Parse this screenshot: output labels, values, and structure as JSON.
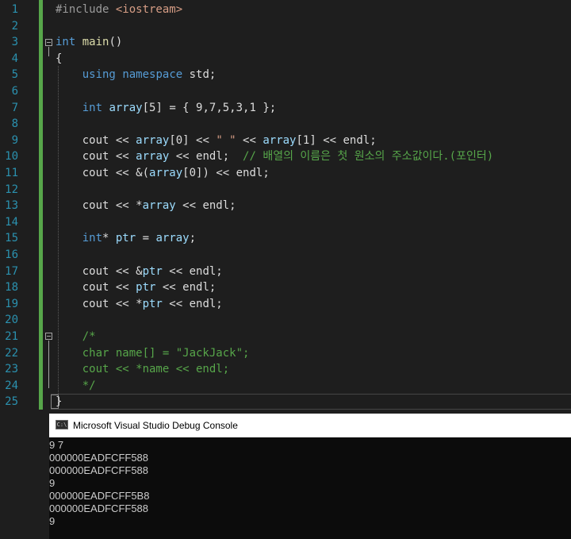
{
  "editor": {
    "line_numbers": [
      "1",
      "2",
      "3",
      "4",
      "5",
      "6",
      "7",
      "8",
      "9",
      "10",
      "11",
      "12",
      "13",
      "14",
      "15",
      "16",
      "17",
      "18",
      "19",
      "20",
      "21",
      "22",
      "23",
      "24",
      "25"
    ],
    "lines": [
      [
        {
          "t": "#include ",
          "c": "pp"
        },
        {
          "t": "<iostream>",
          "c": "inc"
        }
      ],
      [],
      [
        {
          "t": "int",
          "c": "kw"
        },
        {
          "t": " "
        },
        {
          "t": "main",
          "c": "fn"
        },
        {
          "t": "()"
        }
      ],
      [
        {
          "t": "{"
        }
      ],
      [
        {
          "t": "    "
        },
        {
          "t": "using",
          "c": "kw"
        },
        {
          "t": " "
        },
        {
          "t": "namespace",
          "c": "kw"
        },
        {
          "t": " std;"
        }
      ],
      [],
      [
        {
          "t": "    "
        },
        {
          "t": "int",
          "c": "kw"
        },
        {
          "t": " "
        },
        {
          "t": "array",
          "c": "var"
        },
        {
          "t": "[5] = { 9,7,5,3,1 };"
        }
      ],
      [],
      [
        {
          "t": "    cout << "
        },
        {
          "t": "array",
          "c": "var"
        },
        {
          "t": "[0] << "
        },
        {
          "t": "\" \"",
          "c": "str"
        },
        {
          "t": " << "
        },
        {
          "t": "array",
          "c": "var"
        },
        {
          "t": "[1] << endl;"
        }
      ],
      [
        {
          "t": "    cout << "
        },
        {
          "t": "array",
          "c": "var"
        },
        {
          "t": " << endl;  "
        },
        {
          "t": "// 배열의 이름은 첫 원소의 주소값이다.(포인터)",
          "c": "cmt"
        }
      ],
      [
        {
          "t": "    cout << &("
        },
        {
          "t": "array",
          "c": "var"
        },
        {
          "t": "[0]) << endl;"
        }
      ],
      [],
      [
        {
          "t": "    cout << *"
        },
        {
          "t": "array",
          "c": "var"
        },
        {
          "t": " << endl;"
        }
      ],
      [],
      [
        {
          "t": "    "
        },
        {
          "t": "int",
          "c": "kw"
        },
        {
          "t": "* "
        },
        {
          "t": "ptr",
          "c": "var"
        },
        {
          "t": " = "
        },
        {
          "t": "array",
          "c": "var"
        },
        {
          "t": ";"
        }
      ],
      [],
      [
        {
          "t": "    cout << &"
        },
        {
          "t": "ptr",
          "c": "var"
        },
        {
          "t": " << endl;"
        }
      ],
      [
        {
          "t": "    cout << "
        },
        {
          "t": "ptr",
          "c": "var"
        },
        {
          "t": " << endl;"
        }
      ],
      [
        {
          "t": "    cout << *"
        },
        {
          "t": "ptr",
          "c": "var"
        },
        {
          "t": " << endl;"
        }
      ],
      [],
      [
        {
          "t": "    "
        },
        {
          "t": "/*",
          "c": "cmt"
        }
      ],
      [
        {
          "t": "    "
        },
        {
          "t": "char name[] = \"JackJack\";",
          "c": "cmt"
        }
      ],
      [
        {
          "t": "    "
        },
        {
          "t": "cout << *name << endl;",
          "c": "cmt"
        }
      ],
      [
        {
          "t": "    "
        },
        {
          "t": "*/",
          "c": "cmt"
        }
      ],
      [
        {
          "t": "}"
        }
      ]
    ]
  },
  "console": {
    "title": "Microsoft Visual Studio Debug Console",
    "icon": "console-app-icon",
    "icon_label": "C:\\",
    "output": [
      "9 7",
      "000000EADFCFF588",
      "000000EADFCFF588",
      "9",
      "000000EADFCFF5B8",
      "000000EADFCFF588",
      "9"
    ]
  },
  "colors": {
    "keyword": "#569cd6",
    "function": "#dcdcaa",
    "variable": "#9cdcfe",
    "string": "#d69d85",
    "comment": "#57a64a",
    "line_number": "#2b91af",
    "change_bar": "#57a64a"
  }
}
